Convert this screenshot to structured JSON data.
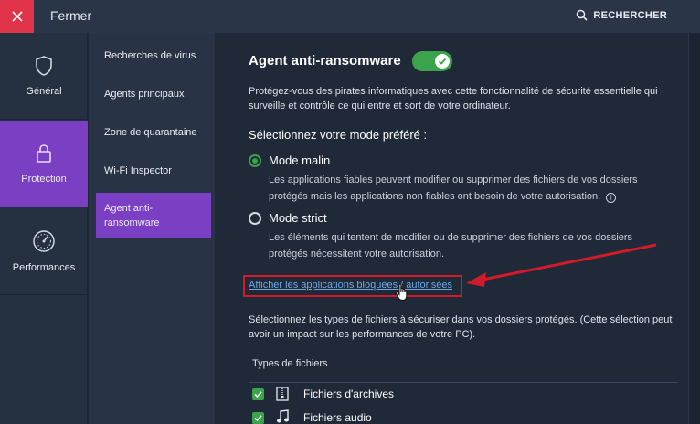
{
  "titlebar": {
    "close_label": "Fermer",
    "search_label": "RECHERCHER"
  },
  "leftnav": {
    "items": [
      {
        "label": "Général",
        "icon": "shield-icon"
      },
      {
        "label": "Protection",
        "icon": "lock-icon",
        "active": true
      },
      {
        "label": "Performances",
        "icon": "gauge-icon"
      }
    ]
  },
  "subnav": {
    "items": [
      {
        "label": "Recherches de virus"
      },
      {
        "label": "Agents principaux"
      },
      {
        "label": "Zone de quarantaine"
      },
      {
        "label": "Wi-Fi Inspector"
      },
      {
        "label": "Agent anti-ransomware",
        "active": true
      }
    ]
  },
  "main": {
    "title": "Agent anti-ransomware",
    "toggle_on": true,
    "description": "Protégez-vous des pirates informatiques avec cette fonctionnalité de sécurité essentielle qui surveille et contrôle ce qui entre et sort de votre ordinateur.",
    "mode_heading": "Sélectionnez votre mode préféré :",
    "modes": [
      {
        "label": "Mode malin",
        "selected": true,
        "desc_line1": "Les applications fiables peuvent modifier ou supprimer des fichiers de vos dossiers",
        "desc_line2": "protégés mais les applications non fiables ont besoin de votre autorisation."
      },
      {
        "label": "Mode strict",
        "selected": false,
        "desc_line1": "Les éléments qui tentent de modifier ou de supprimer des fichiers de vos dossiers",
        "desc_line2": "protégés nécessitent votre autorisation."
      }
    ],
    "link_text": "Afficher les applications bloquées / autorisées",
    "filetypes_description": "Sélectionnez les types de fichiers à sécuriser dans vos dossiers protégés. (Cette sélection peut avoir un impact sur les performances de votre PC).",
    "filetypes_heading": "Types de fichiers",
    "filetypes": [
      {
        "label": "Fichiers d'archives",
        "checked": true,
        "icon": "archive-icon"
      },
      {
        "label": "Fichiers audio",
        "checked": true,
        "icon": "music-icon"
      }
    ]
  },
  "colors": {
    "accent": "#7b3fc4",
    "close_red": "#e0344a",
    "toggle_green": "#3aa34b",
    "link_blue": "#6ea8e8",
    "highlight_red": "#d11a2a"
  }
}
